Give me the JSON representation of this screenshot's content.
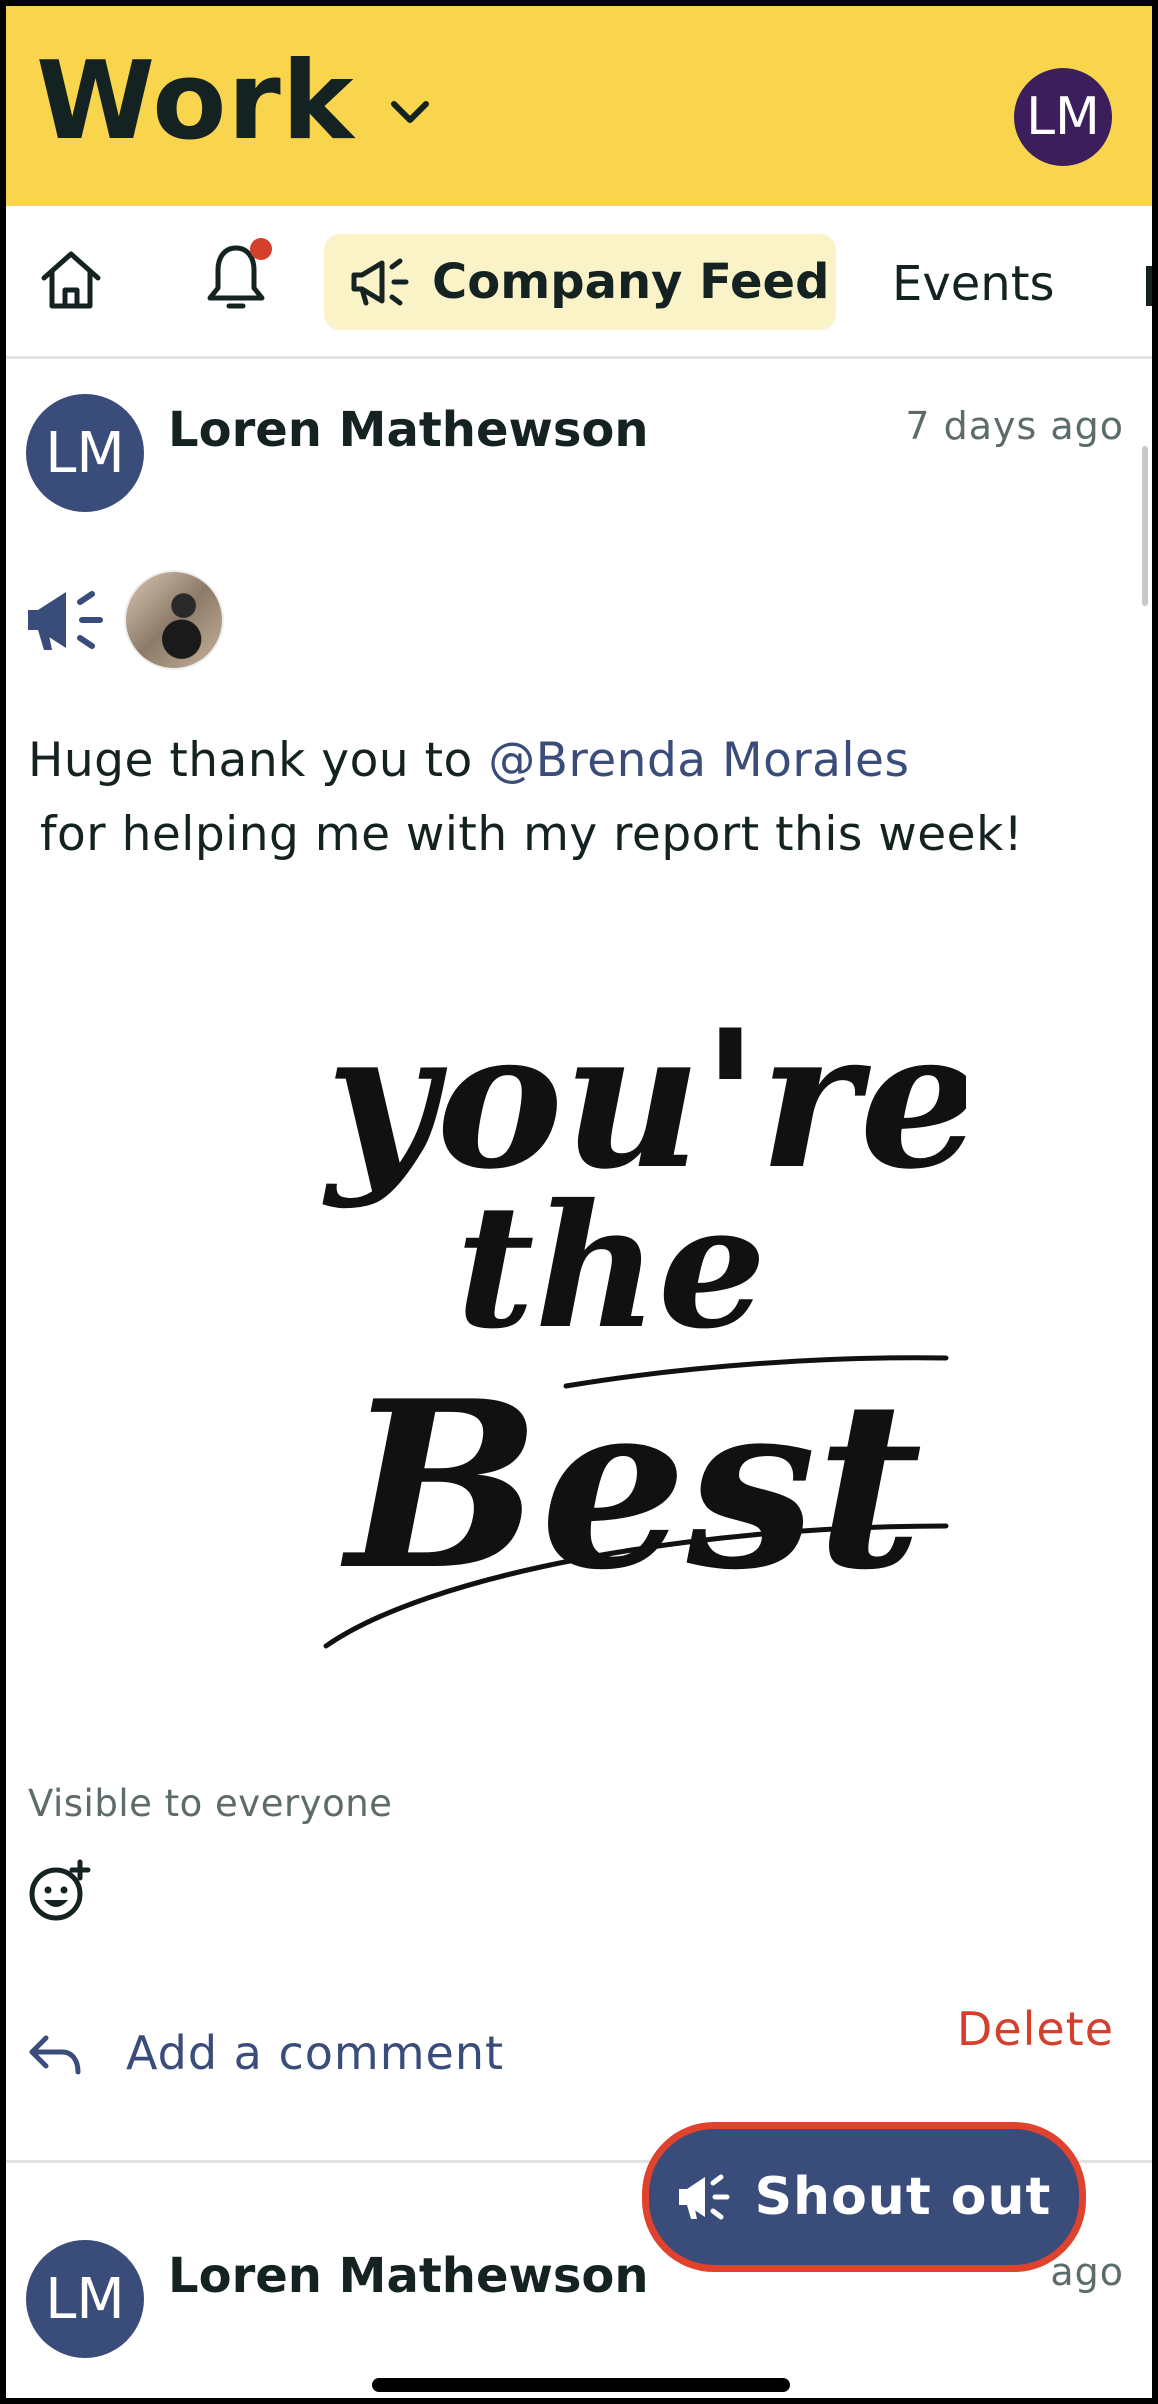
{
  "header": {
    "title": "Work",
    "user_initials": "LM"
  },
  "tabs": {
    "home_icon": "home-icon",
    "notifications_icon": "bell-icon",
    "active_label": "Company Feed",
    "events_label": "Events"
  },
  "posts": [
    {
      "author": "Loren Mathewson",
      "initials": "LM",
      "time": "7 days ago",
      "text_prefix": "Huge thank you to ",
      "mention": "@Brenda Morales",
      "text_suffix": "for helping me with my report this week!",
      "image_text": [
        "you're",
        "the",
        "Best"
      ],
      "visibility": "Visible to everyone",
      "comment_placeholder": "Add a comment",
      "delete_label": "Delete"
    },
    {
      "author": "Loren Mathewson",
      "initials": "LM",
      "time": "ago"
    }
  ],
  "fab": {
    "label": "Shout out"
  },
  "colors": {
    "header_bg": "#f8d54c",
    "accent": "#3a4c7a",
    "danger": "#d4402b",
    "active_tab_bg": "#fbf3c8"
  }
}
